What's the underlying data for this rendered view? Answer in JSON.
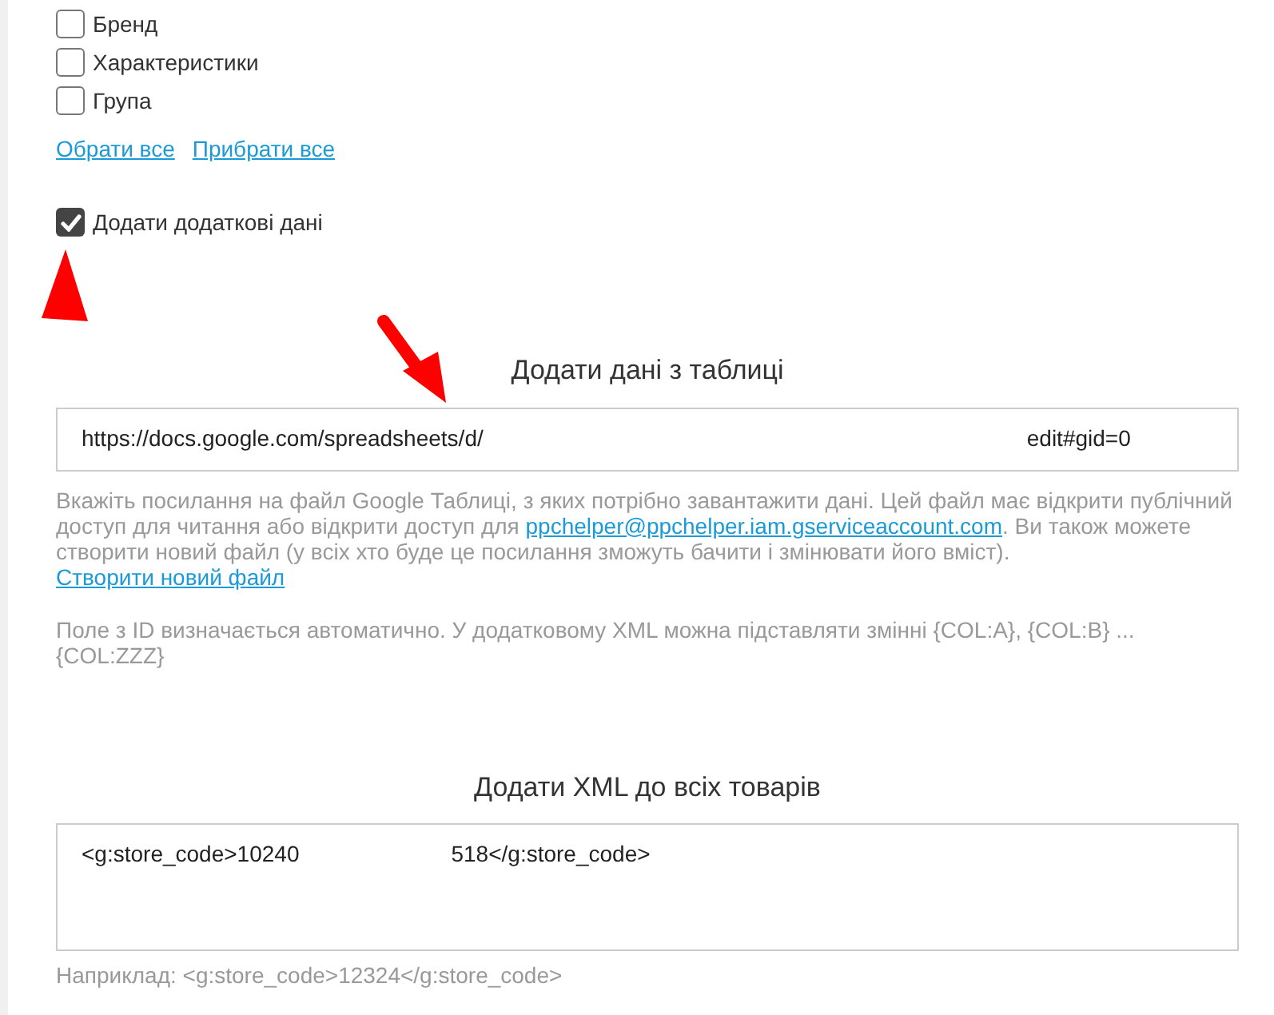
{
  "checkboxes": [
    {
      "label": "Бренд",
      "checked": false
    },
    {
      "label": "Характеристики",
      "checked": false
    },
    {
      "label": "Група",
      "checked": false
    }
  ],
  "links": [
    "Обрати все",
    "Прибрати все"
  ],
  "extra_data": {
    "label": "Додати додаткові дані",
    "checked": true
  },
  "sheet_section": {
    "title": "Додати дані з таблиці",
    "value_start": "https://docs.google.com/spreadsheets/d/",
    "value_end": "edit#gid=0",
    "help": [
      {
        "parts": [
          {
            "kind": "text",
            "text": "Вкажіть посилання на файл Google Таблиці, з яких потрібно завантажити дані. Цей файл має відкрити публічний доступ для читання або відкрити доступ для "
          },
          {
            "kind": "link",
            "text": "ppchelper@ppchelper.iam.gserviceaccount.com"
          },
          {
            "kind": "text",
            "text": ". Ви також можете створити новий файл (у всіх хто буде це посилання зможуть бачити і змінювати його вміст). "
          },
          {
            "kind": "link",
            "text": "Створити новий файл"
          }
        ]
      },
      {
        "parts": [
          {
            "kind": "text",
            "text": "Поле з ID визначається автоматично. У додатковому XML можна підставляти змінні {COL:A}, {COL:B} ... {COL:ZZZ}"
          }
        ]
      }
    ]
  },
  "xml_section": {
    "title": "Додати XML до всіх товарів",
    "value_start": "<g:store_code>10240",
    "value_end": "518</g:store_code>",
    "hint": "Наприклад: <g:store_code>12324</g:store_code>"
  }
}
